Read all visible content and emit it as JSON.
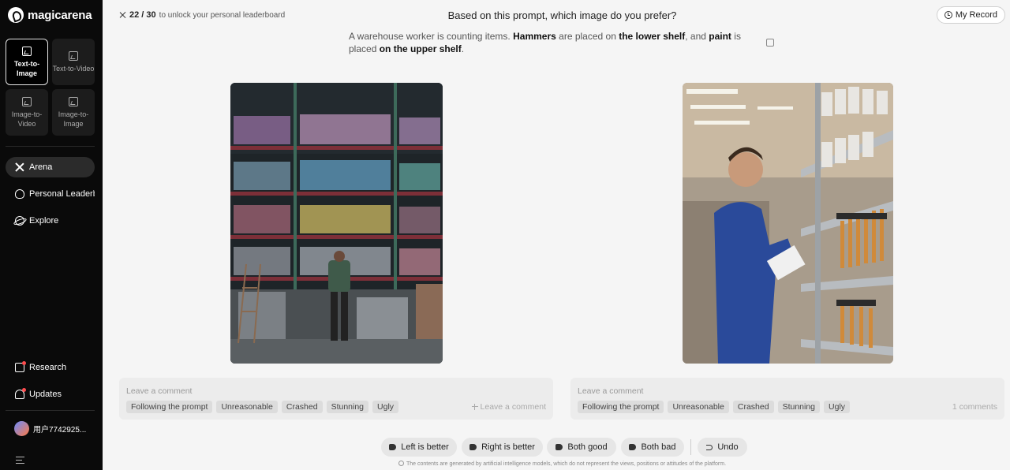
{
  "app": {
    "logo_text": "magicarena"
  },
  "sidebar": {
    "modes": [
      {
        "label": "Text-to-Image",
        "active": true
      },
      {
        "label": "Text-to-Video",
        "active": false
      },
      {
        "label": "Image-to-Video",
        "active": false
      },
      {
        "label": "Image-to-Image",
        "active": false
      }
    ],
    "nav": [
      {
        "label": "Arena",
        "icon": "arena-icon",
        "active": true
      },
      {
        "label": "Personal Leaderboard",
        "icon": "leaderboard-icon",
        "active": false
      },
      {
        "label": "Explore",
        "icon": "explore-icon",
        "active": false
      }
    ],
    "bottom": [
      {
        "label": "Research",
        "icon": "research-icon",
        "badge": true
      },
      {
        "label": "Updates",
        "icon": "bell-icon",
        "badge": true
      }
    ],
    "user_name": "用户7742925..."
  },
  "header": {
    "progress_current": "22",
    "progress_total": "30",
    "progress_text": "to unlock your personal leaderboard",
    "question": "Based on this prompt, which image do you prefer?",
    "my_record": "My Record"
  },
  "prompt": {
    "p1": "A warehouse worker is counting items. ",
    "b1": "Hammers",
    "p2": " are placed on ",
    "b2": "the lower shelf",
    "p3": ", and ",
    "b3": "paint",
    "p4": " is placed ",
    "b4": "on the upper shelf",
    "p5": "."
  },
  "panels": {
    "left": {
      "placeholder": "Leave a comment",
      "tags": [
        "Following the prompt",
        "Unreasonable",
        "Crashed",
        "Stunning",
        "Ugly"
      ],
      "link": "Leave a comment"
    },
    "right": {
      "placeholder": "Leave a comment",
      "tags": [
        "Following the prompt",
        "Unreasonable",
        "Crashed",
        "Stunning",
        "Ugly"
      ],
      "link": "1 comments"
    }
  },
  "votes": {
    "left_better": "Left is better",
    "right_better": "Right is better",
    "both_good": "Both good",
    "both_bad": "Both bad",
    "undo": "Undo"
  },
  "disclaimer": "The contents are generated by artificial intelligence models, which do not represent the views, positions or attitudes of the platform.",
  "colors": {
    "sidebar_bg": "#0a0a0a",
    "page_bg": "#f5f5f5",
    "badge": "#ff4d4f"
  }
}
